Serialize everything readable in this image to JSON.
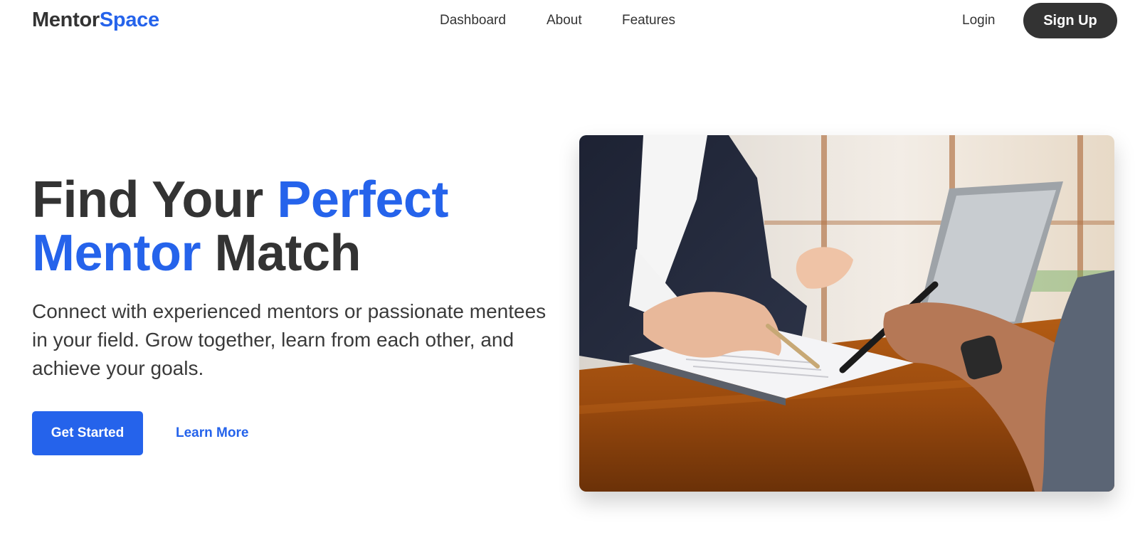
{
  "brand": {
    "name_part1": "Mentor",
    "name_part2": "Space",
    "accent_color": "#2563eb",
    "text_color": "#333333"
  },
  "nav": {
    "items": [
      {
        "label": "Dashboard"
      },
      {
        "label": "About"
      },
      {
        "label": "Features"
      }
    ]
  },
  "auth": {
    "login_label": "Login",
    "signup_label": "Sign Up"
  },
  "hero": {
    "title_part1": "Find Your ",
    "title_accent1": "Perfect",
    "title_accent2": "Mentor",
    "title_part2": " Match",
    "subtitle": "Connect with experienced mentors or passionate mentees in your field. Grow together, learn from each other, and achieve your goals.",
    "primary_cta": "Get Started",
    "secondary_cta": "Learn More",
    "image": {
      "icon": "photo-mentoring-meeting"
    }
  }
}
